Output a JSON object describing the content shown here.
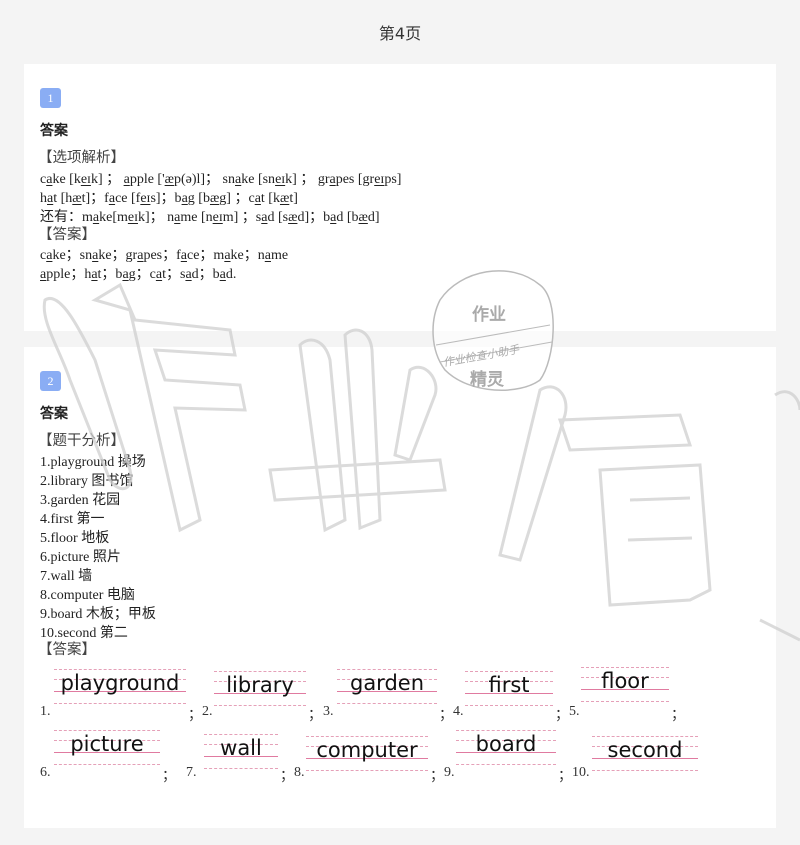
{
  "page": {
    "title": "第4页"
  },
  "colors": {
    "badge": "#8aadf4",
    "fill_line": "#e07aa0",
    "background": "#f4f4f4"
  },
  "question1": {
    "number": "1",
    "answer_title": "答案",
    "analysis_header": "【选项解析】",
    "lines": [
      "cake [keɪk] ；  apple ['æp(ə)l]；  snake [sneɪk] ；  grapes [greɪps]",
      "hat  [hæt]；face  [feɪs]；bag  [bæg] ；cat [kæt]",
      "还有：make[meɪk]；  name [neɪm] ；sad [sæd]；bad [bæd]"
    ],
    "answer_header": "【答案】",
    "answers": [
      "cake；snake；grapes；face；make；name",
      "apple；hat；bag；cat；sad；bad."
    ]
  },
  "question2": {
    "number": "2",
    "answer_title": "答案",
    "analysis_header": "【题干分析】",
    "vocab": [
      "1.playground 操场",
      "2.library 图书馆",
      "3.garden 花园",
      "4.first 第一",
      "5.floor 地板",
      "6.picture 照片",
      "7.wall 墙",
      "8.computer 电脑",
      "9.board 木板；甲板",
      "10.second 第二"
    ],
    "answer_header": "【答案】",
    "blanks": [
      {
        "num": "1.",
        "word": "playground"
      },
      {
        "num": "2.",
        "word": "library"
      },
      {
        "num": "3.",
        "word": "garden"
      },
      {
        "num": "4.",
        "word": "first"
      },
      {
        "num": "5.",
        "word": "floor"
      },
      {
        "num": "6.",
        "word": "picture"
      },
      {
        "num": "7.",
        "word": "wall"
      },
      {
        "num": "8.",
        "word": "computer"
      },
      {
        "num": "9.",
        "word": "board"
      },
      {
        "num": "10.",
        "word": "second"
      }
    ],
    "separator": "；"
  },
  "watermark": {
    "big_text": "作业精灵",
    "stamp_top": "作业",
    "stamp_middle": "作业检查小助手",
    "stamp_bottom": "精灵"
  }
}
